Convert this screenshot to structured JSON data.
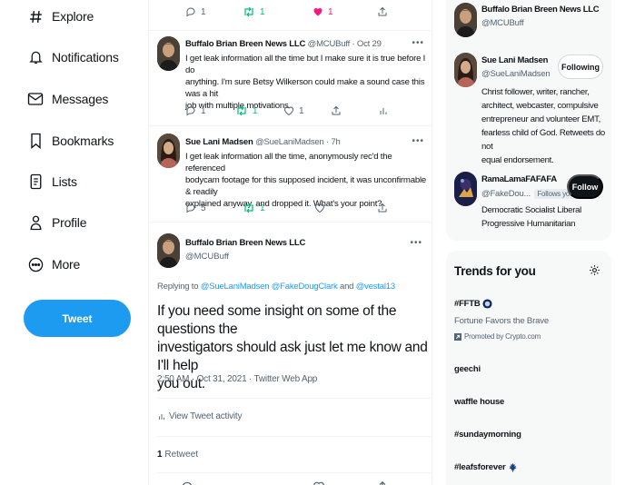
{
  "nav": [
    {
      "key": "explore",
      "label": "Explore",
      "icon": "hashtag-icon"
    },
    {
      "key": "notifications",
      "label": "Notifications",
      "icon": "bell-icon"
    },
    {
      "key": "messages",
      "label": "Messages",
      "icon": "envelope-icon"
    },
    {
      "key": "bookmarks",
      "label": "Bookmarks",
      "icon": "bookmark-icon"
    },
    {
      "key": "lists",
      "label": "Lists",
      "icon": "list-icon"
    },
    {
      "key": "profile",
      "label": "Profile",
      "icon": "person-icon"
    },
    {
      "key": "more",
      "label": "More",
      "icon": "more-circle-icon"
    }
  ],
  "tweet_button": "Tweet",
  "colors": {
    "accent": "#1d9bf0",
    "retweet": "#00ba7c",
    "like": "#f91880",
    "muted": "#536471"
  },
  "top_actions": {
    "reply_count": "1",
    "retweet_count": "1",
    "like_count": "1"
  },
  "tweets": [
    {
      "name": "Buffalo Brian Breen News LLC",
      "handle": "@MCUBuff",
      "time": "Oct 29",
      "lines": [
        "I get leak information all the time but I make sure it is true before I do",
        "anything. I'm sure Betsy Wilkerson could make a sound case this was a hit",
        "job with multiple motivations."
      ],
      "reply_count": "1",
      "retweet_count": "1",
      "like_count": "1"
    },
    {
      "name": "Sue Lani Madsen",
      "handle": "@SueLaniMadsen",
      "time": "7h",
      "lines": [
        "I get leak information all the time, anonymously rec'd the referenced",
        "bodycam footage for this supposed incident, it was unconfirmable & readily",
        "explained anyway,  and dropped it.  What's your point?"
      ],
      "reply_count": "5",
      "retweet_count": "1",
      "like_count": ""
    }
  ],
  "detail": {
    "name": "Buffalo Brian Breen News LLC",
    "handle": "@MCUBuff",
    "replying_prefix": "Replying to ",
    "replying_users": "@SueLaniMadsen @FakeDougClark",
    "replying_and": " and ",
    "replying_last": "@vestal13",
    "text_lines": [
      "If you need some insight on some of the questions the",
      "investigators should ask just let me know and I'll help",
      "you out."
    ],
    "meta": "2:50 AM · Oct 31, 2021 · Twitter Web App",
    "activity_label": "View Tweet activity",
    "retweet_count": "1",
    "retweet_label": "Retweet"
  },
  "who": [
    {
      "name": "Buffalo Brian Breen News LLC",
      "handle": "@MCUBuff"
    },
    {
      "name": "Sue Lani Madsen",
      "handle": "@SueLaniMadsen",
      "button": "Following",
      "bio_lines": [
        "Christ follower, writer, rancher,",
        "architect, webcaster, compulsive",
        "entrepreneur and volunteer EMT,",
        "fearless child of God. Retweets do not",
        "equal endorsement."
      ]
    },
    {
      "name": "RamaLamaFAFAFA",
      "handle": "@FakeDou...",
      "follows_you": "Follows you",
      "button": "Follow",
      "bio_lines": [
        "Democratic Socialist Liberal",
        "Progressive Humanitarian"
      ]
    }
  ],
  "trends": {
    "title": "Trends for you",
    "items": [
      {
        "name": "#FFTB",
        "sub": "Fortune Favors the Brave",
        "promo": "Promoted by Crypto.com"
      },
      {
        "name": "geechi"
      },
      {
        "name": "waffle house"
      },
      {
        "name": "#sundaymorning"
      },
      {
        "name": "#leafsforever"
      }
    ]
  }
}
